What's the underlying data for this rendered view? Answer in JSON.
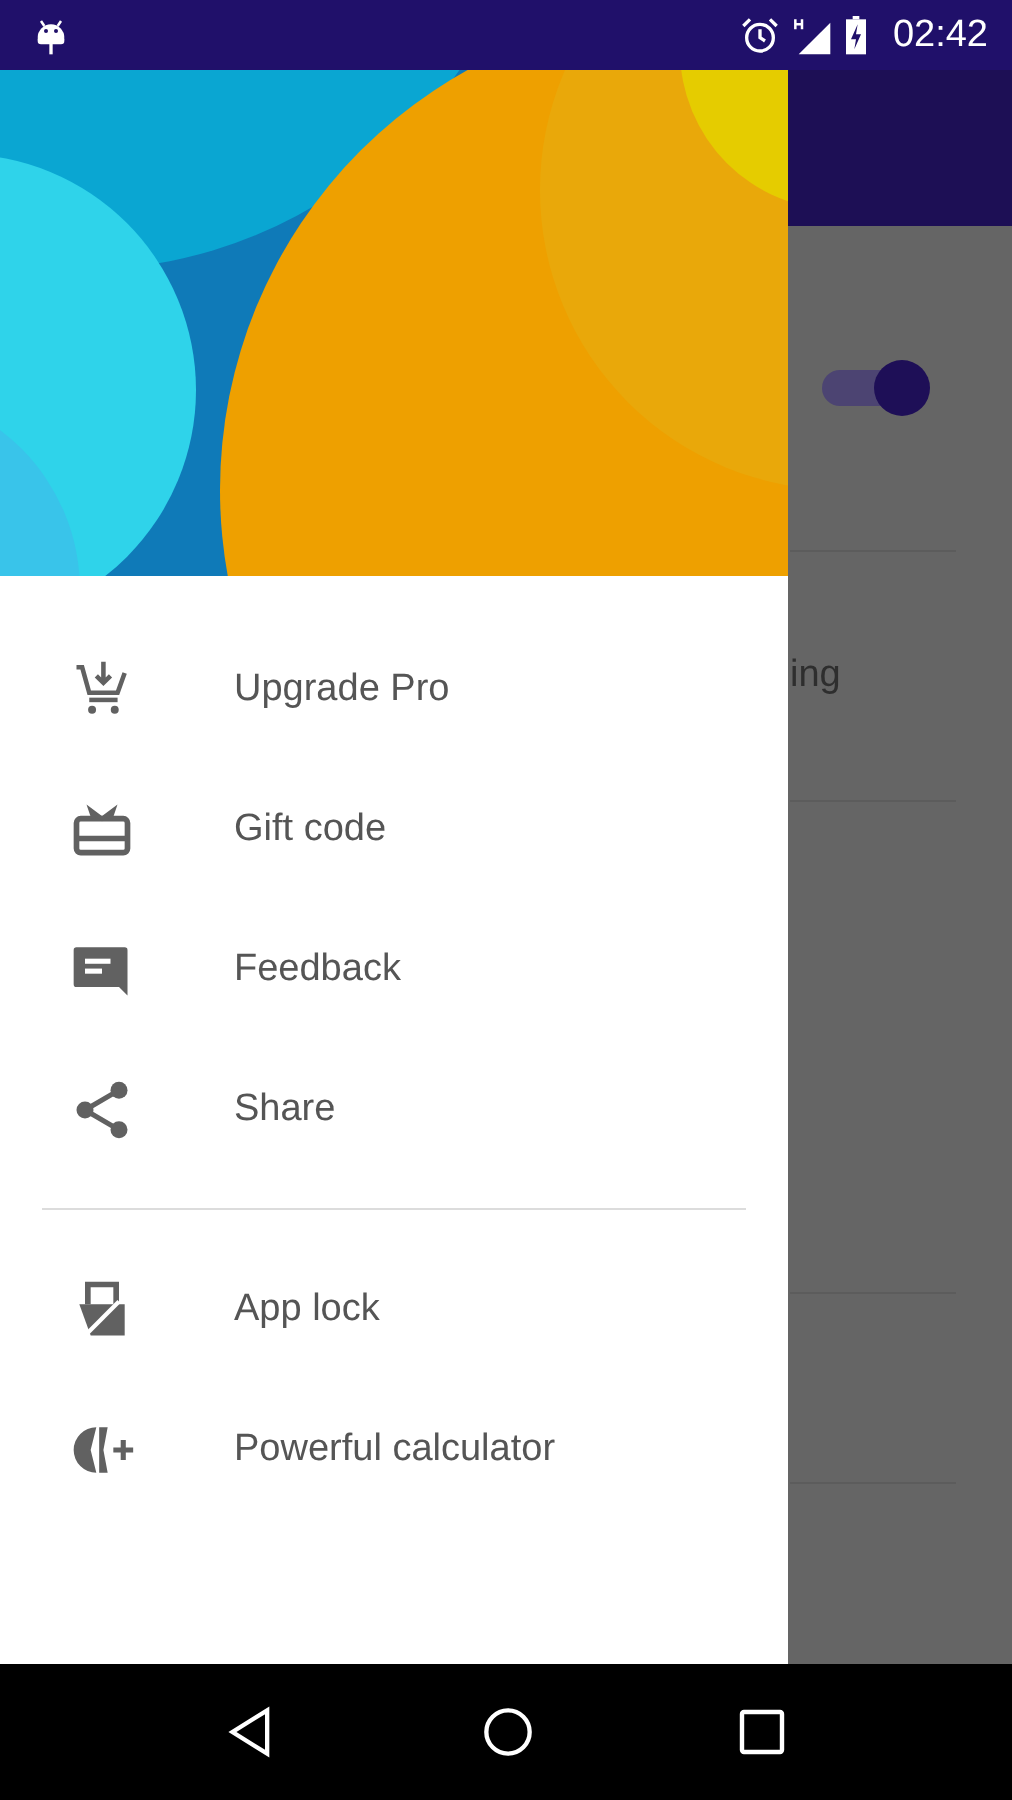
{
  "status_bar": {
    "time": "02:42"
  },
  "background": {
    "switch_on": true,
    "text_fragment": "ing"
  },
  "drawer": {
    "sections": [
      {
        "items": [
          {
            "kind": "cart",
            "label": "Upgrade Pro"
          },
          {
            "kind": "gift",
            "label": "Gift code"
          },
          {
            "kind": "feedback",
            "label": "Feedback"
          },
          {
            "kind": "share",
            "label": "Share"
          }
        ]
      },
      {
        "items": [
          {
            "kind": "applock",
            "label": "App lock"
          },
          {
            "kind": "calculator",
            "label": "Powerful calculator"
          }
        ]
      }
    ]
  }
}
